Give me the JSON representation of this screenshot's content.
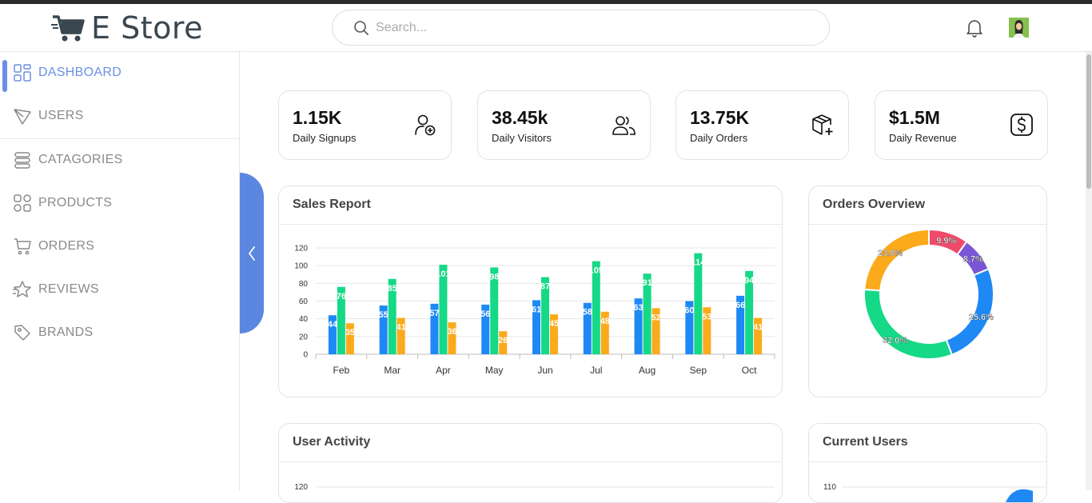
{
  "brand": {
    "name": "E Store"
  },
  "search": {
    "placeholder": "Search..."
  },
  "sidebar": {
    "items": [
      {
        "label": "DASHBOARD",
        "icon": "dashboard-grid-icon",
        "active": true
      },
      {
        "label": "USERS",
        "icon": "send-icon",
        "active": false
      },
      {
        "label": "CATAGORIES",
        "icon": "layers-icon",
        "active": false
      },
      {
        "label": "PRODUCTS",
        "icon": "shapes-icon",
        "active": false
      },
      {
        "label": "ORDERS",
        "icon": "cart-icon",
        "active": false
      },
      {
        "label": "REVIEWS",
        "icon": "star-icon",
        "active": false
      },
      {
        "label": "BRANDS",
        "icon": "tag-icon",
        "active": false
      }
    ]
  },
  "stats": [
    {
      "value": "1.15K",
      "label": "Daily Signups",
      "icon": "user-plus-icon"
    },
    {
      "value": "38.45k",
      "label": "Daily Visitors",
      "icon": "users-icon"
    },
    {
      "value": "13.75K",
      "label": "Daily Orders",
      "icon": "package-plus-icon"
    },
    {
      "value": "$1.5M",
      "label": "Daily Revenue",
      "icon": "dollar-icon"
    }
  ],
  "cards": {
    "sales": {
      "title": "Sales Report"
    },
    "orders": {
      "title": "Orders Overview"
    },
    "activity": {
      "title": "User Activity",
      "top_tick": "120"
    },
    "current": {
      "title": "Current Users",
      "top_tick": "110"
    }
  },
  "chart_data": [
    {
      "type": "bar",
      "categories": [
        "Feb",
        "Mar",
        "Apr",
        "May",
        "Jun",
        "Jul",
        "Aug",
        "Sep",
        "Oct"
      ],
      "series": [
        {
          "values": [
            44,
            55,
            57,
            56,
            61,
            58,
            63,
            60,
            66
          ],
          "color": "#1e88f5"
        },
        {
          "values": [
            76,
            85,
            101,
            98,
            87,
            105,
            91,
            114,
            94
          ],
          "color": "#15d986"
        },
        {
          "values": [
            35,
            41,
            36,
            26,
            45,
            48,
            52,
            53,
            41
          ],
          "color": "#fbaa1b"
        }
      ],
      "yticks": [
        "0",
        "20",
        "40",
        "60",
        "80",
        "100",
        "120"
      ],
      "ylim": [
        0,
        120
      ],
      "grid": true
    },
    {
      "type": "pie",
      "donut": true,
      "slices": [
        {
          "value": 9.9,
          "label": "9.9%",
          "color": "#f04a6a"
        },
        {
          "value": 8.7,
          "label": "8.7%",
          "color": "#7a56d6"
        },
        {
          "value": 25.6,
          "label": "25.6%",
          "color": "#1e88f5"
        },
        {
          "value": 32.0,
          "label": "32.0%",
          "color": "#15d986"
        },
        {
          "value": 23.8,
          "label": "23.8%",
          "color": "#fbaa1b"
        }
      ]
    }
  ]
}
